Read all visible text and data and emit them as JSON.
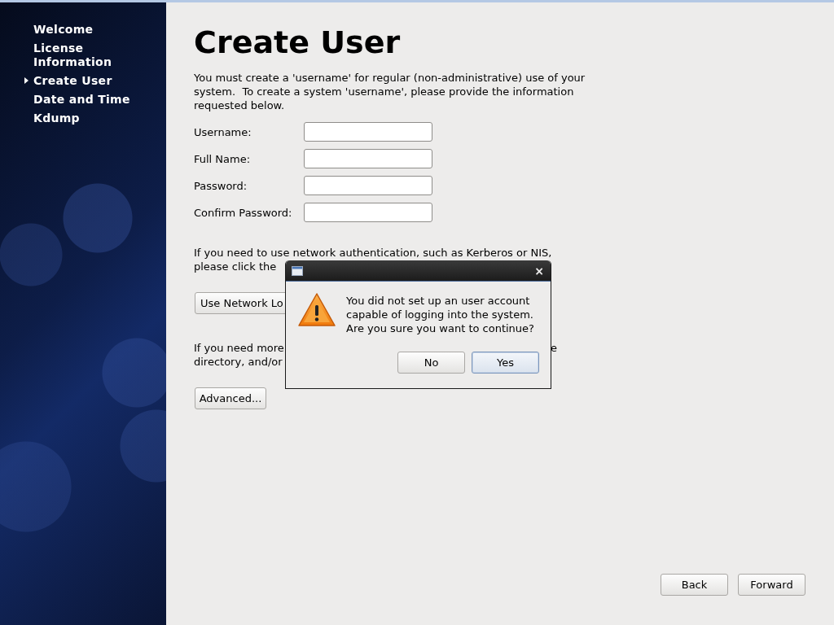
{
  "sidebar": {
    "items": [
      {
        "label": "Welcome",
        "selected": false
      },
      {
        "label": "License Information",
        "selected": false
      },
      {
        "label": "Create User",
        "selected": true
      },
      {
        "label": "Date and Time",
        "selected": false
      },
      {
        "label": "Kdump",
        "selected": false
      }
    ]
  },
  "page": {
    "title": "Create User",
    "intro": "You must create a 'username' for regular (non-administrative) use of your system.  To create a system 'username', please provide the information requested below.",
    "fields": [
      {
        "label": "Username:"
      },
      {
        "label": "Full Name:"
      },
      {
        "label": "Password:"
      },
      {
        "label": "Confirm Password:"
      }
    ],
    "network_text": [
      "If you need to use network authentication, such as Kerberos or NIS,",
      "please click the"
    ],
    "network_button": "Use Network Lo",
    "advanced_text": {
      "line_1": "If you need more",
      "line_1_end": "e",
      "line_2": "directory, and/or"
    },
    "advanced_button": "Advanced...",
    "nav_buttons": [
      "Back",
      "Forward"
    ]
  },
  "dialog": {
    "message": "You did not set up an user account capable of logging into the system. Are you sure you want to continue?",
    "close": "×",
    "buttons": [
      {
        "label": "No",
        "default": false
      },
      {
        "label": "Yes",
        "default": true
      }
    ]
  }
}
